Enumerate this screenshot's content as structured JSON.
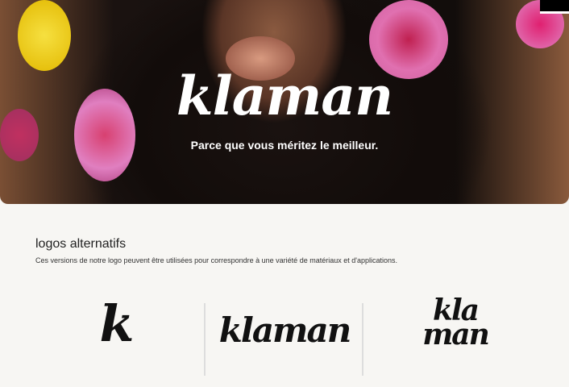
{
  "hero": {
    "brand": "klaman",
    "tagline": "Parce que vous méritez le meilleur."
  },
  "section": {
    "title": "logos alternatifs",
    "description": "Ces versions de notre logo peuvent être utilisées pour correspondre à une variété de matériaux et d'applications."
  },
  "logos": [
    {
      "text": "k"
    },
    {
      "text": "klaman"
    },
    {
      "line1": "kla",
      "line2": "man"
    }
  ]
}
